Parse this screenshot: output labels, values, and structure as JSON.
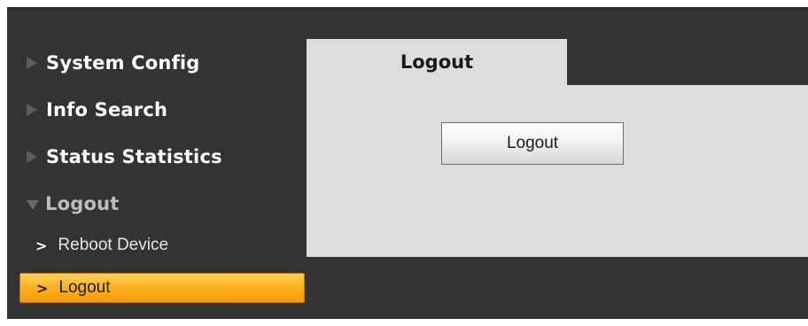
{
  "sidebar": {
    "menus": [
      {
        "label": "System Config",
        "expanded": false
      },
      {
        "label": "Info Search",
        "expanded": false
      },
      {
        "label": "Status Statistics",
        "expanded": false
      },
      {
        "label": "Logout",
        "expanded": true
      }
    ],
    "subitems": [
      {
        "label": "Reboot Device",
        "active": false
      },
      {
        "label": "Logout",
        "active": true
      }
    ]
  },
  "main": {
    "tab_label": "Logout",
    "button_label": "Logout"
  },
  "colors": {
    "frame_bg": "#333333",
    "panel_bg": "#dddddd",
    "active_item": "#fdb321",
    "collapsed_arrow": "#5d5d5d"
  },
  "icons": {
    "collapsed": "triangle-right-icon",
    "expanded": "triangle-down-icon",
    "subitem": "chevron-right-icon"
  }
}
